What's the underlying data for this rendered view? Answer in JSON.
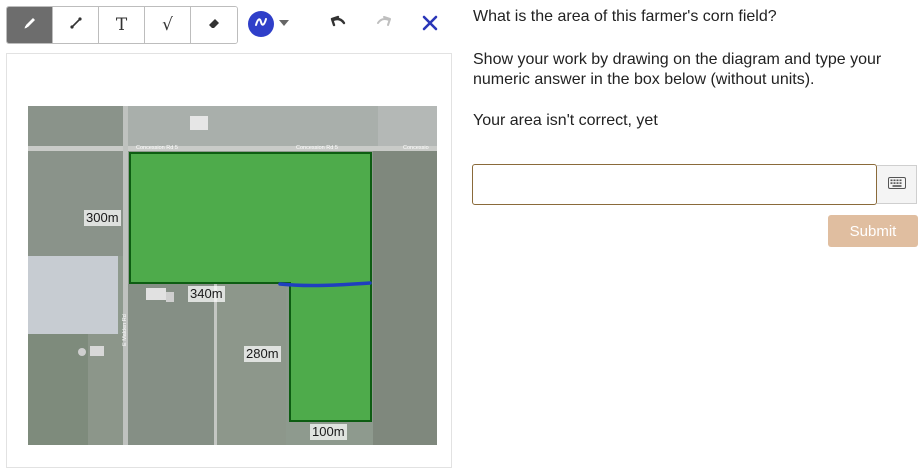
{
  "toolbar": {
    "tools": [
      {
        "name": "pencil-icon",
        "label": "",
        "active": true
      },
      {
        "name": "line-icon",
        "label": "",
        "active": false
      },
      {
        "name": "text-tool",
        "label": "T",
        "active": false
      },
      {
        "name": "sqrt-tool",
        "label": "√",
        "active": false
      },
      {
        "name": "eraser-icon",
        "label": "",
        "active": false
      }
    ],
    "pen_color": "#2f3fc9"
  },
  "diagram": {
    "labels": {
      "left_side": "300m",
      "middle_top": "340m",
      "middle_side": "280m",
      "bottom": "100m"
    },
    "road_labels": {
      "road_1": "Concession Rd 5",
      "road_2": "Concession Rd 5",
      "road_3": "Concessio",
      "road_vertical": "E Malden Rd"
    },
    "field_color": "#3fae3c",
    "field_outline_color": "#0d5d12",
    "drawn_line_color": "#1f3fbf"
  },
  "question": {
    "prompt": "What is the area of this farmer's corn field?",
    "instructions": "Show your work by drawing on the diagram and type your numeric answer in the box below (without units).",
    "status": "Your area isn't correct, yet"
  },
  "answer": {
    "value": "",
    "placeholder": ""
  },
  "submit_label": "Submit",
  "colors": {
    "submit_bg": "#e0bea0",
    "input_border": "#8a6a3a"
  }
}
